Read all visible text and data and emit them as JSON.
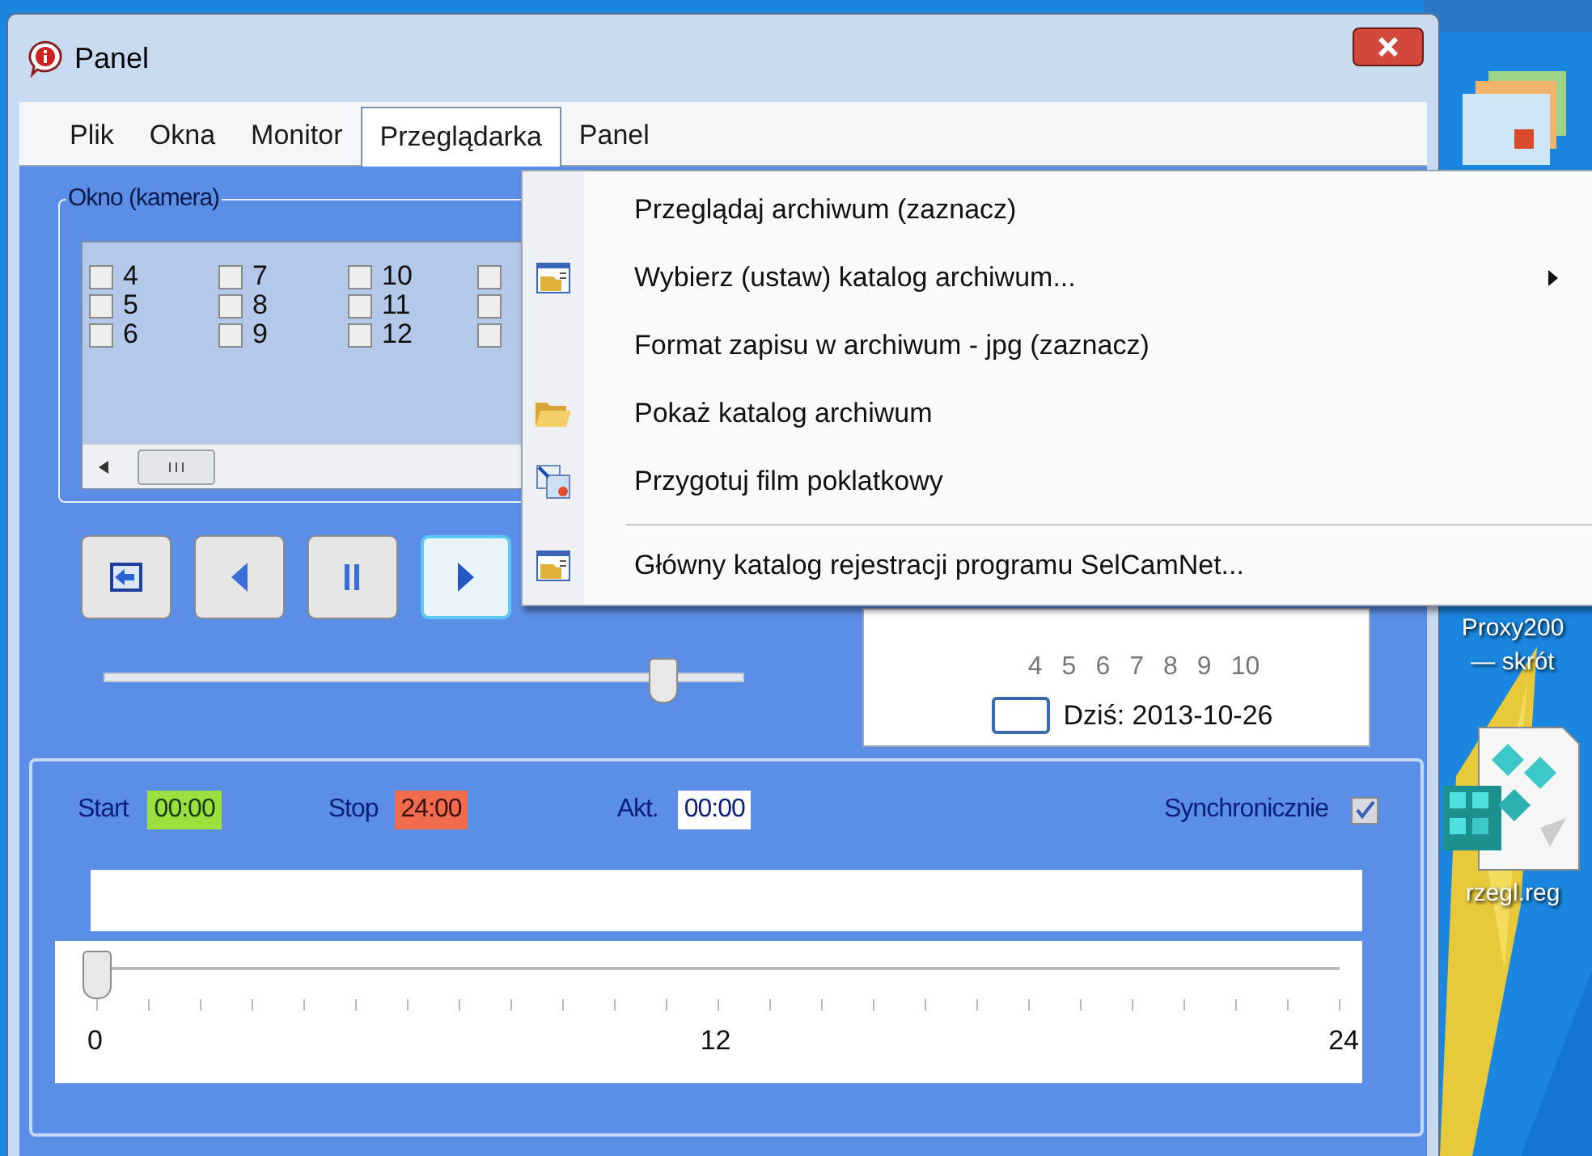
{
  "window": {
    "title": "Panel"
  },
  "menu_bar": [
    {
      "label": "Plik",
      "selected": false
    },
    {
      "label": "Okna",
      "selected": false
    },
    {
      "label": "Monitor",
      "selected": false
    },
    {
      "label": "Przeglądarka",
      "selected": true
    },
    {
      "label": "Panel",
      "selected": false
    }
  ],
  "camera_group": {
    "title": "Okno (kamera)",
    "columns": [
      [
        {
          "label": "4",
          "checked": false
        },
        {
          "label": "5",
          "checked": false
        },
        {
          "label": "6",
          "checked": false
        }
      ],
      [
        {
          "label": "7",
          "checked": false
        },
        {
          "label": "8",
          "checked": false
        },
        {
          "label": "9",
          "checked": false
        }
      ],
      [
        {
          "label": "10",
          "checked": false
        },
        {
          "label": "11",
          "checked": false
        },
        {
          "label": "12",
          "checked": false
        }
      ],
      [
        {
          "checked": false
        },
        {
          "checked": false
        },
        {
          "checked": false
        }
      ]
    ]
  },
  "playback_buttons": [
    {
      "kind": "back",
      "focused": false
    },
    {
      "kind": "prev",
      "focused": false
    },
    {
      "kind": "pause",
      "focused": false
    },
    {
      "kind": "play",
      "focused": true
    }
  ],
  "speed_slider": {
    "level": 0.87
  },
  "calendar": {
    "days": [
      "4",
      "5",
      "6",
      "7",
      "8",
      "9",
      "10"
    ],
    "today": "Dziś: 2013-10-26"
  },
  "timeline": {
    "start_label": "Start",
    "start": "00:00",
    "stop_label": "Stop",
    "stop": "24:00",
    "current_label": "Akt.",
    "current": "00:00",
    "sync_label": "Synchronicznie",
    "sync_checked": true,
    "slider": {
      "level": 0,
      "scale": [
        "0",
        "12",
        "24"
      ]
    }
  },
  "dropdown": [
    {
      "kind": "plain",
      "label": "Przeglądaj archiwum (zaznacz)",
      "submenu": false
    },
    {
      "kind": "window",
      "label": "Wybierz (ustaw) katalog archiwum...",
      "submenu": true
    },
    {
      "kind": "plain",
      "label": "Format zapisu w archiwum - jpg (zaznacz)",
      "submenu": false
    },
    {
      "kind": "folder",
      "label": "Pokaż katalog archiwum",
      "submenu": false
    },
    {
      "kind": "film",
      "label": "Przygotuj film poklatkowy",
      "submenu": false
    },
    {
      "kind": "separator"
    },
    {
      "kind": "window",
      "label": "Główny katalog rejestracji programu SelCamNet...",
      "submenu": false
    }
  ],
  "desktop_icons": [
    {
      "kind": "shortcut",
      "lines": [
        "Proxy200",
        "— skrót"
      ]
    },
    {
      "kind": "registry",
      "lines": [
        "rzegl.reg"
      ]
    }
  ]
}
